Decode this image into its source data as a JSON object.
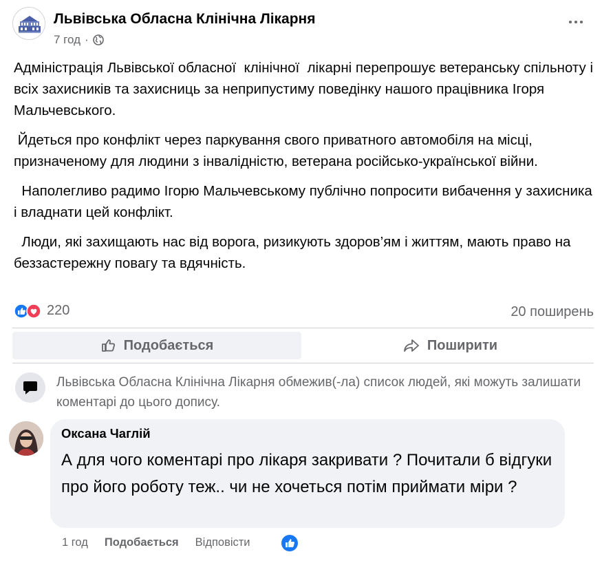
{
  "post": {
    "page_name": "Львівська Обласна Клінічна Лікарня",
    "time": "7 год",
    "separator": "·",
    "privacy_icon": "globe-icon",
    "paragraphs": [
      "Адміністрація Львівської обласної  клінічної  лікарні перепрошує ветеранську спільноту і всіх захисників та захисниць за неприпустиму поведінку нашого працівника Ігоря Мальчевського.",
      " Йдеться про конфлікт через паркування свого приватного автомобіля на місці, призначеному для людини з інвалідністю, ветерана російсько-української війни.",
      "  Наполегливо радимо Ігорю Мальчевському публічно попросити вибачення у захисника і владнати цей конфлікт.",
      "  Люди, які захищають нас від ворога, ризикують здоров’ям і життям, мають право на беззастережну повагу та вдячність."
    ]
  },
  "stats": {
    "reaction_count": "220",
    "reaction_icons": [
      "like-icon",
      "love-icon"
    ],
    "shares": "20 поширень"
  },
  "actions": {
    "like_label": "Подобається",
    "share_label": "Поширити"
  },
  "notice": {
    "text": "Львівська Обласна Клінічна Лікарня обмежив(-ла) список людей, які можуть залишати коментарі до цього допису."
  },
  "comment": {
    "author": "Оксана Чаглій",
    "text": "А для чого коментарі про лікаря закривати ? Почитали б відгуки про його роботу теж.. чи не хочеться потім приймати міри ?",
    "time": "1 год",
    "like_label": "Подобається",
    "reply_label": "Відповісти"
  },
  "colors": {
    "text_primary": "#050505",
    "text_secondary": "#65676b",
    "like_blue": "#1877f2",
    "love_red": "#f33e58",
    "bubble_bg": "#f0f2f5"
  }
}
